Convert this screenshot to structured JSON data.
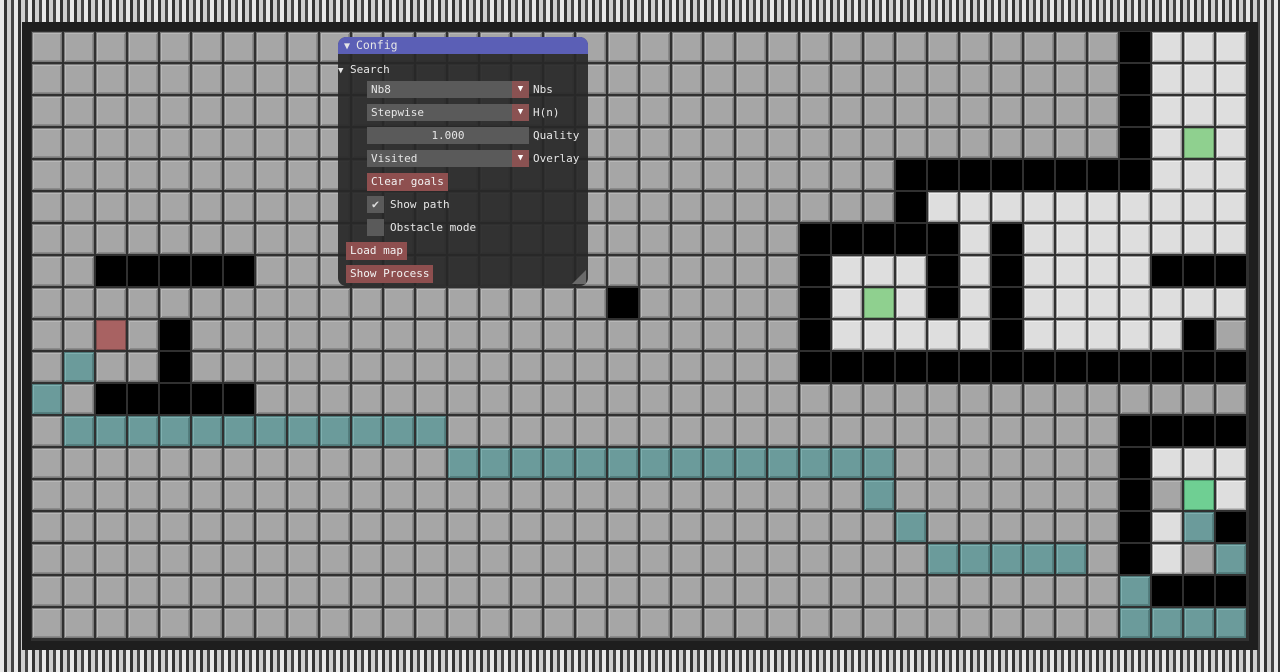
{
  "config": {
    "title": "Config",
    "section": "Search",
    "neighbours": {
      "value": "Nb8",
      "label": "Nbs"
    },
    "heuristic": {
      "value": "Stepwise",
      "label": "H(n)"
    },
    "quality": {
      "value": "1.000",
      "label": "Quality"
    },
    "overlay": {
      "value": "Visited",
      "label": "Overlay"
    },
    "clear_goals_label": "Clear goals",
    "show_path": {
      "label": "Show path",
      "checked": true
    },
    "obstacle_mode": {
      "label": "Obstacle mode",
      "checked": false
    },
    "load_map_label": "Load map",
    "show_process_label": "Show Process"
  },
  "colors": {
    "floor": "#a6a6a6",
    "wall": "#000000",
    "visited": "#dedede",
    "path": "#6b9b9b",
    "start": "#a86262",
    "goal": "#8fd08f",
    "window_title": "#5b5fb6",
    "button": "#8e4f4f"
  },
  "grid": {
    "cols": 38,
    "rows": 19,
    "legend": {
      ".": "floor",
      "#": "wall",
      "o": "visited",
      "p": "path",
      "S": "start",
      "G": "goal",
      "g": "goal"
    },
    "map": [
      "..................................#oooo",
      "..................................#oooo",
      "..................................#oooo",
      "..................................#oGoo",
      "...........................########ooo",
      "...........................#oooooooooo",
      "........................#####o#oooooooo",
      "..#####.................#ooo#o#oooo####",
      "..................#.....#oGo#o#oooooooo",
      "..S.#...................#ooooo#ooooo#.",
      ".p..#...................##############.",
      "p.#####...............................",
      ".pppppppppppp.....................#####",
      ".............pppppppppppppp.......#oooo",
      "..........................p.......#.goo",
      "...........................p......#op##",
      "............................ppppp.#o.p.",
      "..................................p####p",
      "..................................pppp."
    ]
  }
}
